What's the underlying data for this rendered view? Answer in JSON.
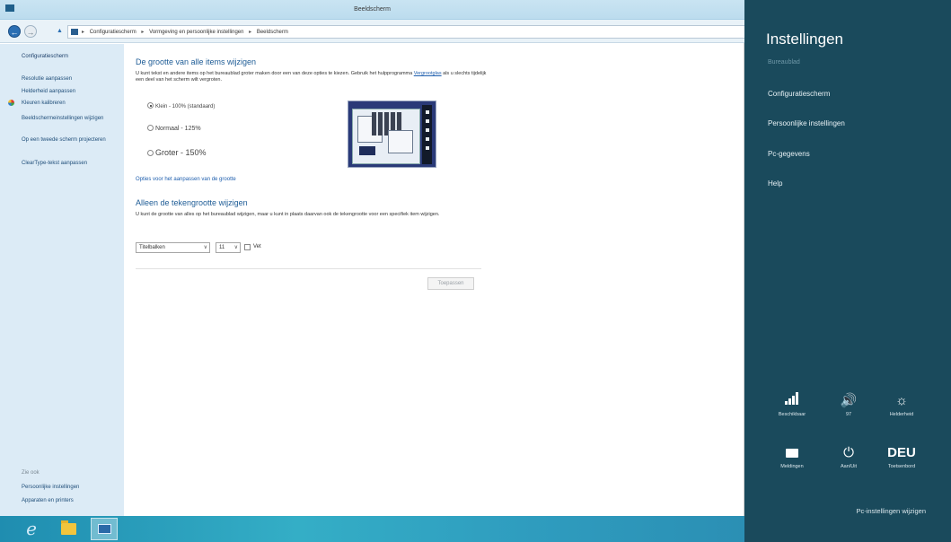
{
  "window": {
    "title": "Beeldscherm",
    "breadcrumb": [
      "Configuratiescherm",
      "Vormgeving en persoonlijke instellingen",
      "Beeldscherm"
    ]
  },
  "left_pane": {
    "home": "Configuratiescherm",
    "links": [
      "Resolutie aanpassen",
      "Helderheid aanpassen",
      "Kleuren kalibreren",
      "Beeldschermeinstellingen wijzigen",
      "Op een tweede scherm projecteren",
      "ClearType-tekst aanpassen"
    ],
    "see_also": "Zie ook",
    "bottom_links": [
      "Persoonlijke instellingen",
      "Apparaten en printers"
    ]
  },
  "main": {
    "heading": "De grootte van alle items wijzigen",
    "description_prefix": "U kunt tekst en andere items op het bureaublad groter maken door een van deze opties te kiezen. Gebruik het hulpprogramma ",
    "description_link": "Vergrootglas",
    "description_suffix": " als u slechts tijdelijk een deel van het scherm wilt vergroten.",
    "size_options": [
      {
        "label": "Klein - 100% (standaard)",
        "selected": true
      },
      {
        "label": "Normaal - 125%",
        "selected": false
      },
      {
        "label": "Groter - 150%",
        "selected": false
      }
    ],
    "custom_size_link": "Opties voor het aanpassen van de grootte",
    "text_heading": "Alleen de tekengrootte wijzigen",
    "text_description": "U kunt de grootte van alles op het bureaublad wijzigen, maar u kunt in plaats daarvan ook de tekengrootte voor een specifiek item wijzigen.",
    "item_select": "Titelbalken",
    "size_select": "11",
    "bold_label": "Vet",
    "apply_button": "Toepassen"
  },
  "charms": {
    "title": "Instellingen",
    "subtitle": "Bureaublad",
    "items": [
      "Configuratiescherm",
      "Persoonlijke instellingen",
      "Pc-gegevens",
      "Help"
    ],
    "quick_settings": [
      {
        "icon": "network-icon",
        "label": "Beschikbaar"
      },
      {
        "icon": "volume-icon",
        "label": "97"
      },
      {
        "icon": "brightness-icon",
        "label": "Helderheid"
      },
      {
        "icon": "keyboard-notifications-icon",
        "label": "Meldingen"
      },
      {
        "icon": "power-icon",
        "label": "Aan/Uit"
      },
      {
        "icon": "keyboard-layout-icon",
        "label": "Toetsenbord",
        "glyph": "DEU"
      }
    ],
    "footer_link": "Pc-instellingen wijzigen"
  },
  "taskbar": {
    "apps": [
      "internet-explorer-icon",
      "file-explorer-icon",
      "control-panel-icon"
    ]
  },
  "colors": {
    "charms_bg": "#1a4a5c",
    "left_pane_bg": "#dcebf6",
    "heading": "#1e5c96",
    "link": "#1f5fae"
  }
}
